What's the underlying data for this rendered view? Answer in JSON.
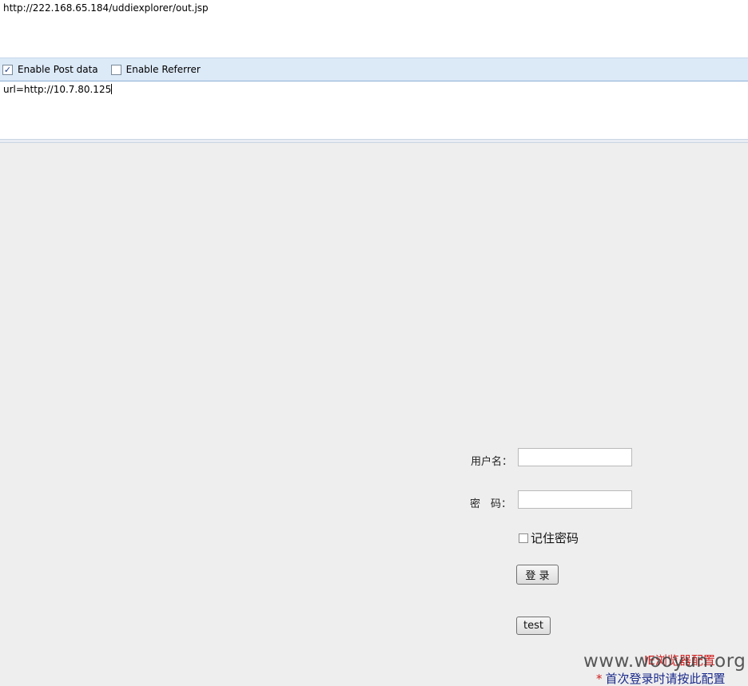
{
  "address": {
    "url": "http://222.168.65.184/uddiexplorer/out.jsp"
  },
  "options": {
    "enable_post": {
      "label": "Enable Post data",
      "checked": true
    },
    "enable_referrer": {
      "label": "Enable Referrer",
      "checked": false
    }
  },
  "post_data": {
    "value": "url=http://10.7.80.125"
  },
  "login_form": {
    "username_label": "用户名：",
    "password_label": "密　码：",
    "remember_label": "记住密码",
    "login_button": "登 录",
    "test_button": "test",
    "ie_config_link": "IE浏览器配置",
    "first_login_star": "*",
    "first_login_note": "首次登录时请按此配置"
  },
  "watermark": "www.wooyun.org",
  "colors": {
    "options_bar": "#dce9f7",
    "page_bg": "#eeeeee",
    "link_red": "#d02020",
    "note_blue": "#1a2a8a"
  }
}
